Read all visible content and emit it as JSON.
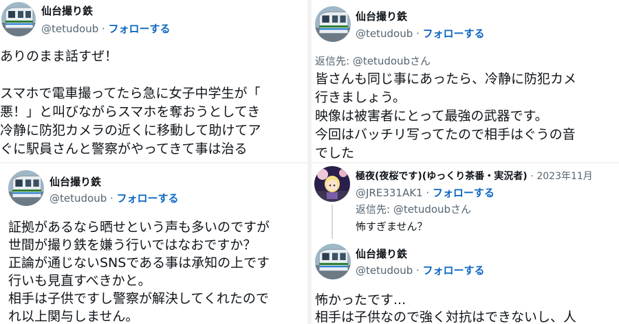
{
  "tweets": [
    {
      "name": "仙台撮り鉄",
      "handle": "@tetudoub",
      "follow": "フォローする",
      "lines": [
        "ありのまま話すぜ！",
        "",
        "スマホで電車撮ってたら急に女子中学生が「",
        "悪！」と叫びながらスマホを奪おうとしてき",
        "冷静に防犯カメラの近くに移動して助けてア",
        "ぐに駅員さんと警察がやってきて事は治る"
      ]
    },
    {
      "name": "仙台撮り鉄",
      "handle": "@tetudoub",
      "follow": "フォローする",
      "lines": [
        "証拠があるなら晒せという声も多いのですが",
        "世間が撮り鉄を嫌う行いではなおですか？",
        "正論が通じないSNSである事は承知の上です",
        "行いも見直すべきかと。",
        "相手は子供ですし警察が解決してくれたので",
        "れ以上関与しません。"
      ]
    },
    {
      "name": "仙台撮り鉄",
      "handle": "@tetudoub",
      "follow": "フォローする",
      "reply_to": "返信先: @tetudoubさん",
      "lines": [
        "皆さんも同じ事にあったら、冷静に防犯カメ",
        "行きましょう。",
        "映像は被害者にとって最強の武器です。",
        "今回はバッチリ写ってたので相手はぐうの音",
        "でした"
      ]
    },
    {
      "name": "極夜(夜桜です)(ゆっくり茶番・実況者)",
      "date": "· 2023年11月",
      "handle": "@JRE331AK1",
      "follow": "フォローする",
      "reply_to": "返信先: @tetudoubさん",
      "lines": [
        "怖すぎません？"
      ]
    },
    {
      "name": "仙台撮り鉄",
      "handle": "@tetudoub",
      "follow": "フォローする",
      "lines": [
        "怖かったです...",
        "相手は子供なので強く対抗はできないし、人"
      ]
    }
  ],
  "icons": {
    "train_avatar": "train-avatar-icon",
    "anime_avatar": "anime-avatar-icon"
  },
  "colors": {
    "follow_link": "#0a66c2",
    "secondary_text": "#536471"
  }
}
